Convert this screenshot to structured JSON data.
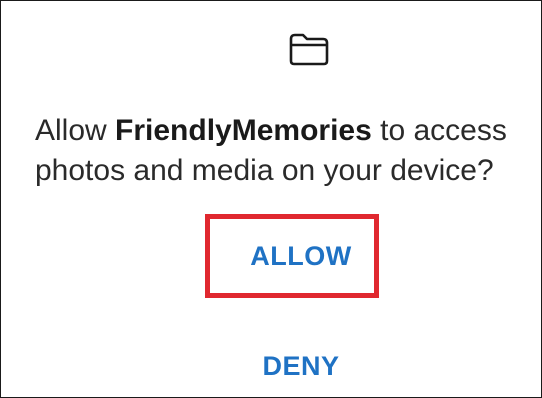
{
  "dialog": {
    "icon": "folder-icon",
    "message": {
      "prefix": "Allow ",
      "app_name": "FriendlyMemories",
      "suffix": " to access photos and media on your device?"
    },
    "allow_label": "ALLOW",
    "deny_label": "DENY"
  },
  "colors": {
    "button_text": "#1f72c4",
    "highlight_border": "#e0282f"
  }
}
